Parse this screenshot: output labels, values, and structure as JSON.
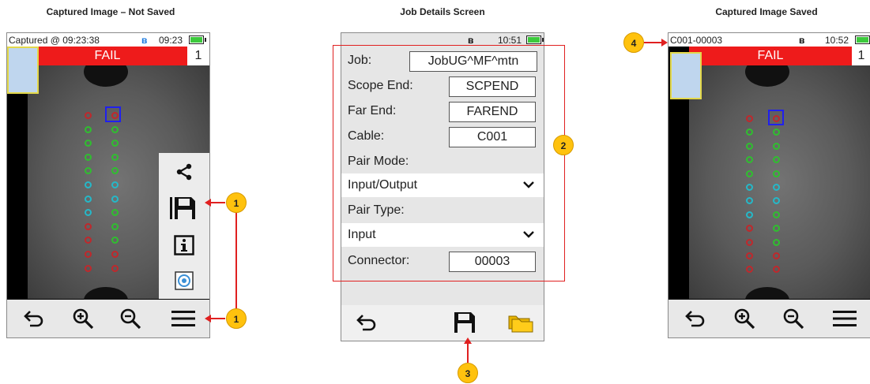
{
  "captions": {
    "left": "Captured Image – Not Saved",
    "middle": "Job Details Screen",
    "right": "Captured Image Saved"
  },
  "left_screen": {
    "status_text": "Captured @ 09:23:38",
    "time": "09:23",
    "result": "FAIL",
    "count": "1",
    "menu_icons": [
      "share-icon",
      "save-icon",
      "info-icon",
      "target-icon"
    ],
    "toolbar_icons": [
      "back-icon",
      "zoom-in-icon",
      "zoom-out-icon",
      "menu-icon"
    ]
  },
  "middle_screen": {
    "time": "10:51",
    "fields": [
      {
        "label": "Job:",
        "value": "JobUG^MF^mtn"
      },
      {
        "label": "Scope End:",
        "value": "SCPEND"
      },
      {
        "label": "Far End:",
        "value": "FAREND"
      },
      {
        "label": "Cable:",
        "value": "C001"
      }
    ],
    "pair_mode_label": "Pair Mode:",
    "pair_mode_value": "Input/Output",
    "pair_type_label": "Pair Type:",
    "pair_type_value": "Input",
    "connector_label": "Connector:",
    "connector_value": "00003",
    "toolbar_icons": [
      "back-icon",
      "save-icon",
      "folder-icon"
    ]
  },
  "right_screen": {
    "status_text": "C001-00003",
    "time": "10:52",
    "result": "FAIL",
    "count": "1",
    "toolbar_icons": [
      "back-icon",
      "zoom-in-icon",
      "zoom-out-icon",
      "menu-icon"
    ]
  },
  "annotations": [
    "1",
    "1",
    "2",
    "3",
    "4"
  ],
  "colors": {
    "fail": "#ee1b1b",
    "callout": "#ffc20e",
    "callout_line": "#e02020",
    "dot_red": "#c0282c",
    "dot_green": "#2fbf2f",
    "dot_cyan": "#25b8c8",
    "selection": "#2020ee"
  }
}
